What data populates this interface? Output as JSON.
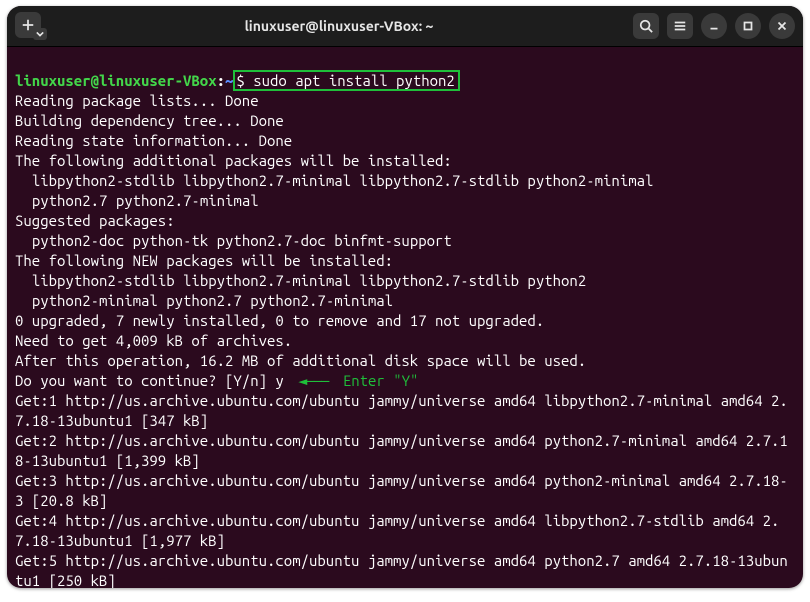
{
  "titlebar": {
    "title": "linuxuser@linuxuser-VBox: ~"
  },
  "prompt": {
    "user_host": "linuxuser@linuxuser-VBox",
    "colon": ":",
    "path": "~",
    "dollar": "$",
    "command": "sudo apt install python2"
  },
  "annotation": {
    "arrow": "◄———",
    "label": "Enter \"Y\""
  },
  "lines": {
    "l01": "Reading package lists... Done",
    "l02": "Building dependency tree... Done",
    "l03": "Reading state information... Done",
    "l04": "The following additional packages will be installed:",
    "l05": "  libpython2-stdlib libpython2.7-minimal libpython2.7-stdlib python2-minimal",
    "l06": "  python2.7 python2.7-minimal",
    "l07": "Suggested packages:",
    "l08": "  python2-doc python-tk python2.7-doc binfmt-support",
    "l09": "The following NEW packages will be installed:",
    "l10": "  libpython2-stdlib libpython2.7-minimal libpython2.7-stdlib python2",
    "l11": "  python2-minimal python2.7 python2.7-minimal",
    "l12": "0 upgraded, 7 newly installed, 0 to remove and 17 not upgraded.",
    "l13": "Need to get 4,009 kB of archives.",
    "l14": "After this operation, 16.2 MB of additional disk space will be used.",
    "l15": "Do you want to continue? [Y/n] y",
    "l16": "Get:1 http://us.archive.ubuntu.com/ubuntu jammy/universe amd64 libpython2.7-minimal amd64 2.7.18-13ubuntu1 [347 kB]",
    "l17": "Get:2 http://us.archive.ubuntu.com/ubuntu jammy/universe amd64 python2.7-minimal amd64 2.7.18-13ubuntu1 [1,399 kB]",
    "l18": "Get:3 http://us.archive.ubuntu.com/ubuntu jammy/universe amd64 python2-minimal amd64 2.7.18-3 [20.8 kB]",
    "l19": "Get:4 http://us.archive.ubuntu.com/ubuntu jammy/universe amd64 libpython2.7-stdlib amd64 2.7.18-13ubuntu1 [1,977 kB]",
    "l20": "Get:5 http://us.archive.ubuntu.com/ubuntu jammy/universe amd64 python2.7 amd64 2.7.18-13ubuntu1 [250 kB]"
  }
}
